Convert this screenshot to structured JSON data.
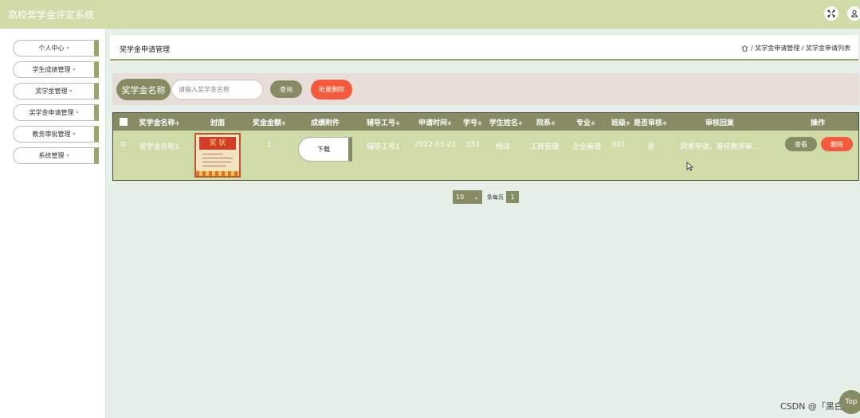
{
  "app": {
    "title": "高校奖学金评定系统"
  },
  "topbar": {
    "fullscreen_icon": "fullscreen-icon",
    "user_icon": "user-icon"
  },
  "sidebar": {
    "items": [
      {
        "label": "个人中心",
        "caret": "▾"
      },
      {
        "label": "学生成绩管理",
        "caret": "▾"
      },
      {
        "label": "奖学金管理",
        "caret": "▾"
      },
      {
        "label": "奖学金申请管理",
        "caret": "▾"
      },
      {
        "label": "教务审批管理",
        "caret": "▾"
      },
      {
        "label": "系统管理",
        "caret": "▾"
      }
    ]
  },
  "header": {
    "title": "奖学金申请管理",
    "breadcrumb": "/ 奖学金申请管理 / 奖学金申请列表",
    "home_icon": "home-icon"
  },
  "search": {
    "label": "奖学金名称",
    "placeholder": "请输入奖学金名称",
    "query_label": "查询",
    "batch_delete_label": "批量删除"
  },
  "table": {
    "columns": [
      "奖学金名称",
      "封面",
      "奖金金额",
      "成绩附件",
      "辅导工号",
      "申请时间",
      "学号",
      "学生姓名",
      "院系",
      "专业",
      "班级",
      "是否审核",
      "审核回复",
      "操作"
    ],
    "sort_glyph": "≑",
    "rows": [
      {
        "name": "奖学金名称1",
        "cover_text": "奖 状",
        "amount": "1",
        "attachment_label": "下载",
        "advisor_id": "辅导工号1",
        "apply_time": "2022-03-22",
        "student_id": "333",
        "student_name": "杨洋",
        "department": "工商管理",
        "major": "企业管理",
        "class": "301",
        "reviewed": "是",
        "reply": "同意申请，等待教务审...",
        "view_label": "查看",
        "delete_label": "删除"
      }
    ]
  },
  "pagination": {
    "page_size": "10",
    "per_page_label": "条每页",
    "current_page": "1"
  },
  "footer": {
    "watermark": "CSDN @「黑白",
    "top_label": "Top"
  },
  "colors": {
    "accent": "#868b63",
    "danger": "#f55a3c",
    "topbar": "#cfdca8",
    "row": "#cfdca8",
    "background": "#e6efe8"
  }
}
